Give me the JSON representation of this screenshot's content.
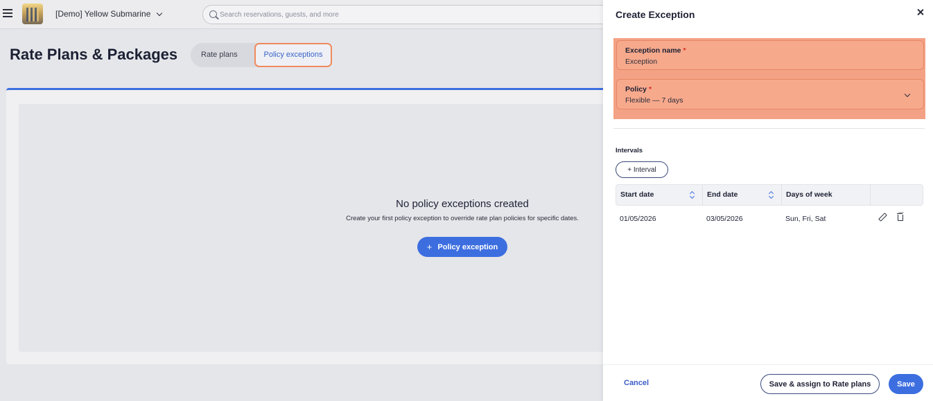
{
  "topbar": {
    "property_name": "[Demo] Yellow Submarine",
    "search_placeholder": "Search reservations, guests, and more"
  },
  "page": {
    "title": "Rate Plans & Packages",
    "tabs": [
      {
        "label": "Rate plans",
        "active": false
      },
      {
        "label": "Policy exceptions",
        "active": true
      }
    ]
  },
  "empty_state": {
    "title": "No policy exceptions created",
    "description": "Create your first policy exception to override rate plan policies for specific dates.",
    "button_label": "Policy exception",
    "button_icon": "+"
  },
  "panel": {
    "title": "Create Exception",
    "fields": {
      "exception_name": {
        "label": "Exception name",
        "required_mark": "*",
        "value": "Exception"
      },
      "policy": {
        "label": "Policy",
        "required_mark": "*",
        "value": "Flexible — 7 days"
      }
    },
    "intervals": {
      "heading": "Intervals",
      "add_button_label": "+ Interval",
      "columns": [
        "Start date",
        "End date",
        "Days of week"
      ],
      "rows": [
        {
          "start_date": "01/05/2026",
          "end_date": "03/05/2026",
          "days_of_week": "Sun, Fri, Sat"
        }
      ]
    },
    "footer": {
      "cancel_label": "Cancel",
      "save_assign_label": "Save & assign to Rate plans",
      "save_label": "Save"
    }
  },
  "colors": {
    "accent": "#3c6ee0",
    "highlight": "#f4a285",
    "required": "#d92d20"
  }
}
